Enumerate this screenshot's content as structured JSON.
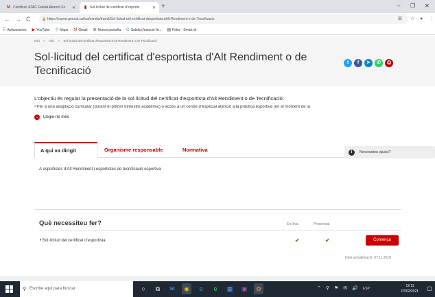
{
  "browser": {
    "tabs": [
      {
        "label": "Certificat: ATAC Fekitat Atenció Fo",
        "icon": "gmail-icon",
        "icon_color": "#d93025"
      },
      {
        "label": "Sol·licitud del certificat d'esportis",
        "icon": "gencat-icon",
        "icon_color": "#c00000"
      }
    ],
    "new_tab": "+",
    "window_controls": [
      "–",
      "❐",
      "✕"
    ],
    "nav": {
      "back": "←",
      "forward": "→",
      "reload": "C"
    },
    "url": "https://esport.gencat.cat/ca/tramits/tramit/Sol·licitud-del-certificat-desportista-dAlt-Rendiment-o-de-Tecnificacio",
    "addr_icons": [
      "⊞",
      "☆",
      "●",
      "⋮"
    ]
  },
  "bookmarks": [
    {
      "label": "Aplicaciones",
      "icon": "apps-icon",
      "glyph": "⠿",
      "color": "#1a73e8"
    },
    {
      "label": "YouTube",
      "icon": "youtube-icon",
      "glyph": "▶",
      "color": "#ff0000"
    },
    {
      "label": "Maps",
      "icon": "maps-icon",
      "glyph": "⚲",
      "color": "#34a853"
    },
    {
      "label": "Gmail",
      "icon": "gmail-icon",
      "glyph": "M",
      "color": "#d93025"
    },
    {
      "label": "Nueva pestaña",
      "icon": "globe-icon",
      "glyph": "⊘",
      "color": "#555"
    },
    {
      "label": "Salida d'estació fà...",
      "icon": "google-icon",
      "glyph": "G",
      "color": "#4285f4"
    },
    {
      "label": "Fetor - Smart dt",
      "icon": "page-icon",
      "glyph": "▤",
      "color": "#666"
    }
  ],
  "page": {
    "breadcrumb": [
      "Inici",
      ">",
      "Inici",
      ">",
      "Sol·licitud del certificat d'esportista d'Alt Rendiment o de Tecnificació"
    ],
    "title": "Sol·licitud del certificat d'esportista d'Alt Rendiment o de Tecnificació",
    "social": [
      {
        "icon": "twitter-icon",
        "glyph": "t",
        "color": "#1da1f2"
      },
      {
        "icon": "facebook-icon",
        "glyph": "f",
        "color": "#3b5998"
      },
      {
        "icon": "telegram-icon",
        "glyph": "➤",
        "color": "#0088cc"
      },
      {
        "icon": "whatsapp-icon",
        "glyph": "✆",
        "color": "#25d366"
      },
      {
        "icon": "print-icon",
        "glyph": "⎙",
        "color": "#c00000"
      }
    ],
    "intro": "L'objectiu és regular la presentació de la sol·licitud del certificat d'esportista d'Alt Rendiment o de Tecnificació:",
    "bullet": "• Per a una adaptació curricular (durant el primer trimestre acadèmic) o accés a un centre d'especial atenció a la pràctica esportiva (en el moment de la",
    "read_more": "Llegiu-ne més",
    "tabs": [
      "A qui va dirigit",
      "Organisme responsable",
      "Normativa"
    ],
    "help": "Necessiteu ajuda?",
    "tab_content": "A esportistes d'Alt Rendiment i esportistes de tecnificació esportiva",
    "need": {
      "title": "Què necessiteu fer?",
      "col_online": "En línia",
      "col_presencial": "Presencial",
      "row": "• Sol·licitud del certificat d'esportista",
      "check": "✔",
      "start_button": "Comença",
      "updated": "Data actualització: 07.11.2018"
    }
  },
  "taskbar": {
    "search_placeholder": "Escribe aquí para buscar",
    "icons": [
      {
        "icon": "cortana-icon",
        "glyph": "○"
      },
      {
        "icon": "taskview-icon",
        "glyph": "⧉"
      },
      {
        "icon": "mail-icon",
        "glyph": "✉"
      },
      {
        "icon": "chrome-icon",
        "glyph": "◉"
      },
      {
        "icon": "edge-icon",
        "glyph": "e"
      },
      {
        "icon": "edge-new-icon",
        "glyph": "e"
      },
      {
        "icon": "store-icon",
        "glyph": "▦"
      },
      {
        "icon": "app-icon",
        "glyph": "▣"
      },
      {
        "icon": "app2-icon",
        "glyph": "✿"
      }
    ],
    "tray": [
      "⌃",
      "⚲",
      "⚑",
      "✉",
      "🔊",
      "ESP"
    ],
    "time": "12:11",
    "date": "07/02/2021",
    "notif": "▢"
  }
}
